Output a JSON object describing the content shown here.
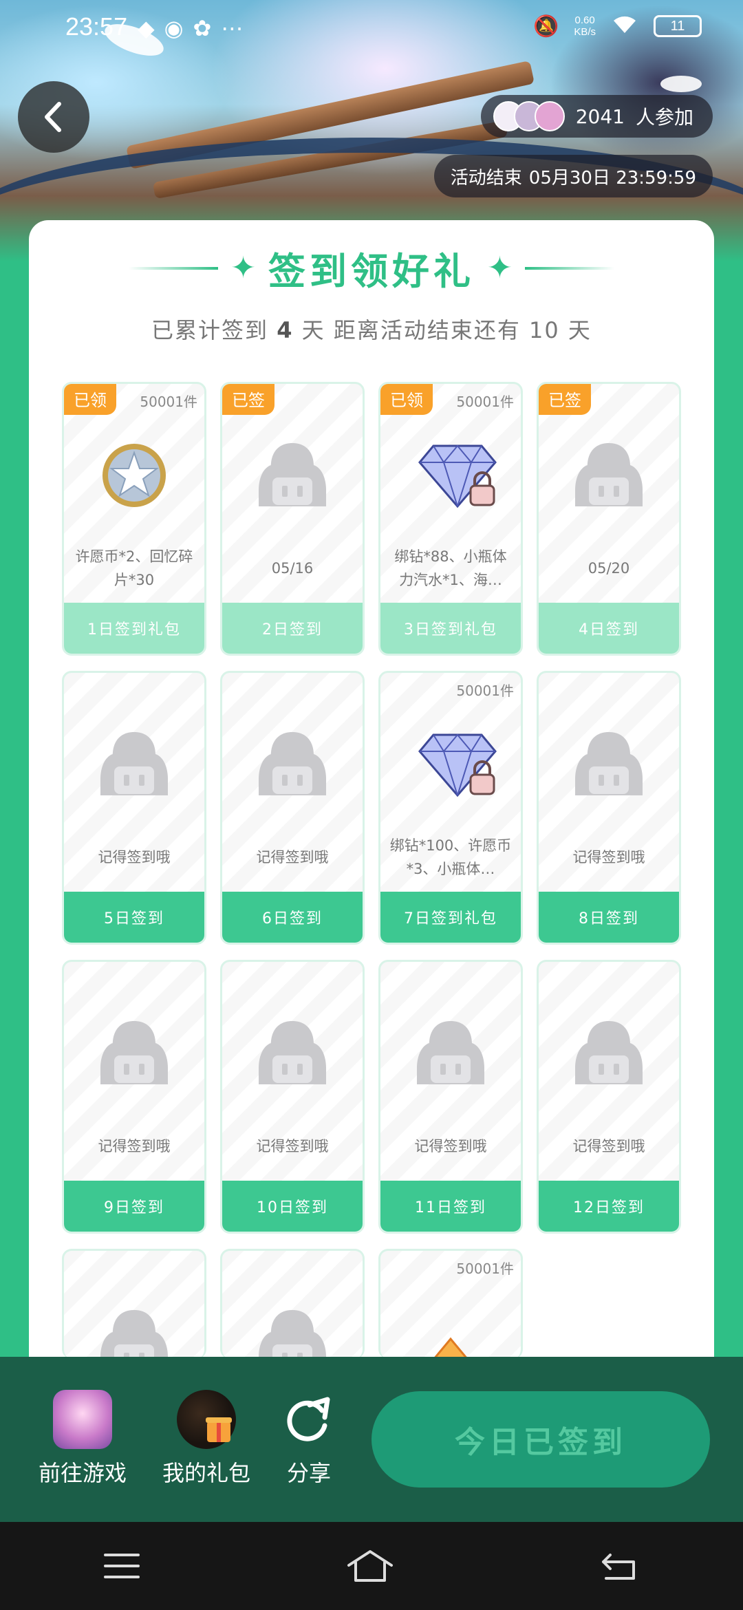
{
  "status_bar": {
    "time": "23:57",
    "net_speed_value": "0.60",
    "net_speed_unit": "KB/s",
    "battery": "11"
  },
  "header": {
    "participants_count": "2041",
    "participants_suffix": "人参加",
    "deadline_label": "活动结束",
    "deadline_value": "05月30日 23:59:59"
  },
  "card": {
    "title": "签到领好礼",
    "sub_prefix": "已累计签到",
    "signed_days": "4",
    "sub_mid": "天  距离活动结束还有",
    "remaining_days": "10",
    "sub_suffix": "天"
  },
  "days": [
    {
      "tag": "已领",
      "stock": "50001件",
      "icon": "coin-icon",
      "desc": "许愿币*2、回忆碎片*30",
      "label": "1日签到礼包",
      "state": "done"
    },
    {
      "tag": "已签",
      "stock": "",
      "icon": "placeholder-icon",
      "desc": "05/16",
      "label": "2日签到",
      "state": "done"
    },
    {
      "tag": "已领",
      "stock": "50001件",
      "icon": "diamond-icon",
      "desc": "绑钻*88、小瓶体力汽水*1、海…",
      "label": "3日签到礼包",
      "state": "done"
    },
    {
      "tag": "已签",
      "stock": "",
      "icon": "placeholder-icon",
      "desc": "05/20",
      "label": "4日签到",
      "state": "done"
    },
    {
      "tag": "",
      "stock": "",
      "icon": "placeholder-icon",
      "desc": "记得签到哦",
      "label": "5日签到",
      "state": "todo"
    },
    {
      "tag": "",
      "stock": "",
      "icon": "placeholder-icon",
      "desc": "记得签到哦",
      "label": "6日签到",
      "state": "todo"
    },
    {
      "tag": "",
      "stock": "50001件",
      "icon": "diamond-icon",
      "desc": "绑钻*100、许愿币*3、小瓶体…",
      "label": "7日签到礼包",
      "state": "todo"
    },
    {
      "tag": "",
      "stock": "",
      "icon": "placeholder-icon",
      "desc": "记得签到哦",
      "label": "8日签到",
      "state": "todo"
    },
    {
      "tag": "",
      "stock": "",
      "icon": "placeholder-icon",
      "desc": "记得签到哦",
      "label": "9日签到",
      "state": "todo"
    },
    {
      "tag": "",
      "stock": "",
      "icon": "placeholder-icon",
      "desc": "记得签到哦",
      "label": "10日签到",
      "state": "todo"
    },
    {
      "tag": "",
      "stock": "",
      "icon": "placeholder-icon",
      "desc": "记得签到哦",
      "label": "11日签到",
      "state": "todo"
    },
    {
      "tag": "",
      "stock": "",
      "icon": "placeholder-icon",
      "desc": "记得签到哦",
      "label": "12日签到",
      "state": "todo"
    },
    {
      "tag": "",
      "stock": "",
      "icon": "placeholder-icon",
      "desc": "",
      "label": "",
      "state": "cut"
    },
    {
      "tag": "",
      "stock": "",
      "icon": "placeholder-icon",
      "desc": "",
      "label": "",
      "state": "cut"
    },
    {
      "tag": "",
      "stock": "50001件",
      "icon": "crystal-icon",
      "desc": "",
      "label": "",
      "state": "cut"
    }
  ],
  "bottom_bar": {
    "game_label": "前往游戏",
    "gift_label": "我的礼包",
    "share_label": "分享",
    "signed_button": "今日已签到"
  },
  "colors": {
    "primary": "#2fbf86",
    "footer_done": "#9be6c6",
    "footer_todo": "#3dc891",
    "tag": "#f9a12a",
    "bottom_bar": "#1b5e48"
  }
}
